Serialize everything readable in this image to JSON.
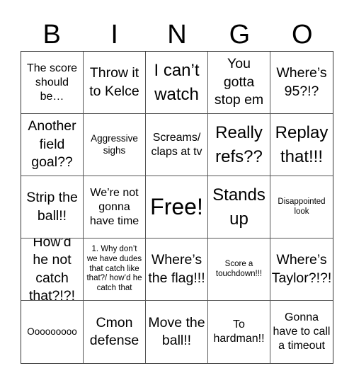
{
  "header": [
    "B",
    "I",
    "N",
    "G",
    "O"
  ],
  "cells": [
    {
      "text": "The score should be…",
      "size": "s-md"
    },
    {
      "text": "Throw it to Kelce",
      "size": "s-lg"
    },
    {
      "text": "I can’t watch",
      "size": "s-xl"
    },
    {
      "text": "You gotta stop em",
      "size": "s-lg"
    },
    {
      "text": "Where’s 95?!?",
      "size": "s-lg"
    },
    {
      "text": "Another field goal??",
      "size": "s-lg"
    },
    {
      "text": "Aggressive sighs",
      "size": "s-sm"
    },
    {
      "text": "Screams/ claps at tv",
      "size": "s-md"
    },
    {
      "text": "Really refs??",
      "size": "s-xl"
    },
    {
      "text": "Replay that!!!",
      "size": "s-xl"
    },
    {
      "text": "Strip the ball!!",
      "size": "s-lg"
    },
    {
      "text": "We’re not gonna have time",
      "size": "s-md"
    },
    {
      "text": "Free!",
      "size": "s-xxl"
    },
    {
      "text": "Stands up",
      "size": "s-xl"
    },
    {
      "text": "Disappointed look",
      "size": "s-xs"
    },
    {
      "text": "How’d he not catch that?!?!",
      "size": "s-lg"
    },
    {
      "text": "1. Why don’t we have dudes that catch like that?/ how’d he catch that",
      "size": "s-xs"
    },
    {
      "text": "Where’s the flag!!!",
      "size": "s-lg"
    },
    {
      "text": "Score a touchdown!!!",
      "size": "s-xs"
    },
    {
      "text": "Where’s Taylor?!?!",
      "size": "s-lg"
    },
    {
      "text": "Ooooooooo",
      "size": "s-sm"
    },
    {
      "text": "Cmon defense",
      "size": "s-lg"
    },
    {
      "text": "Move the ball!!",
      "size": "s-lg"
    },
    {
      "text": "To hardman!!",
      "size": "s-md"
    },
    {
      "text": "Gonna have to call a timeout",
      "size": "s-md"
    }
  ]
}
